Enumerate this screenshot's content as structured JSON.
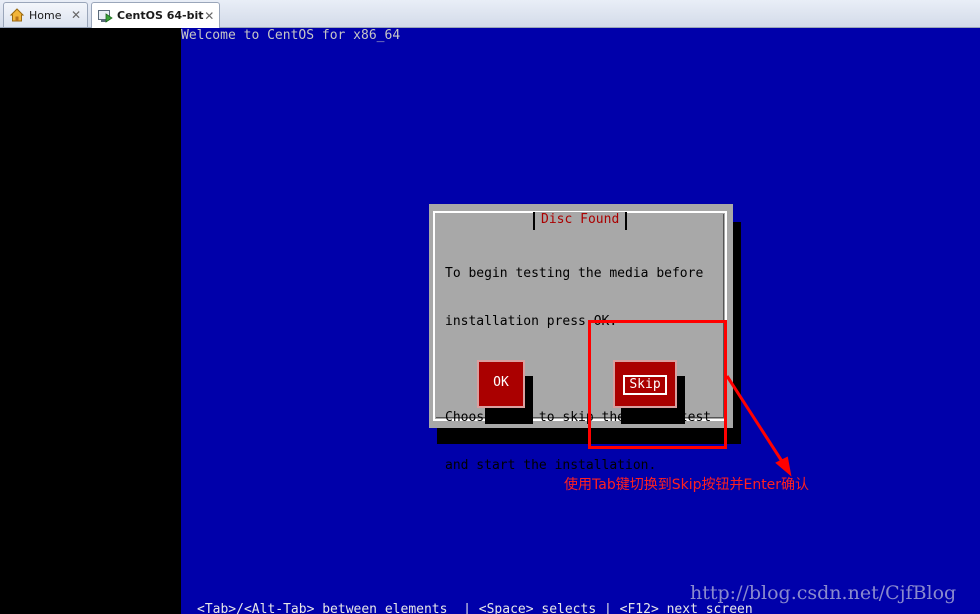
{
  "tabs": [
    {
      "label": "Home",
      "icon": "home-icon"
    },
    {
      "label": "CentOS 64-bit",
      "icon": "vm-icon"
    }
  ],
  "console": {
    "welcome": "Welcome to CentOS for x86_64",
    "bottom_hint": "<Tab>/<Alt-Tab> between elements  | <Space> selects | <F12> next screen"
  },
  "dialog": {
    "title": "Disc Found",
    "line1": "To begin testing the media before",
    "line2": "installation press OK.",
    "line3": "Choose Skip to skip the media test",
    "line4": "and start the installation.",
    "ok_label": "OK",
    "skip_label": "Skip"
  },
  "annotation": {
    "text": "使用Tab键切换到Skip按钮并Enter确认",
    "color": "#ff0000"
  },
  "watermark": "http://blog.csdn.net/CjfBlog",
  "colors": {
    "console_bg": "#0000aa",
    "dialog_bg": "#a8a8a8",
    "button_bg": "#aa0000",
    "title_fg": "#aa0000"
  }
}
